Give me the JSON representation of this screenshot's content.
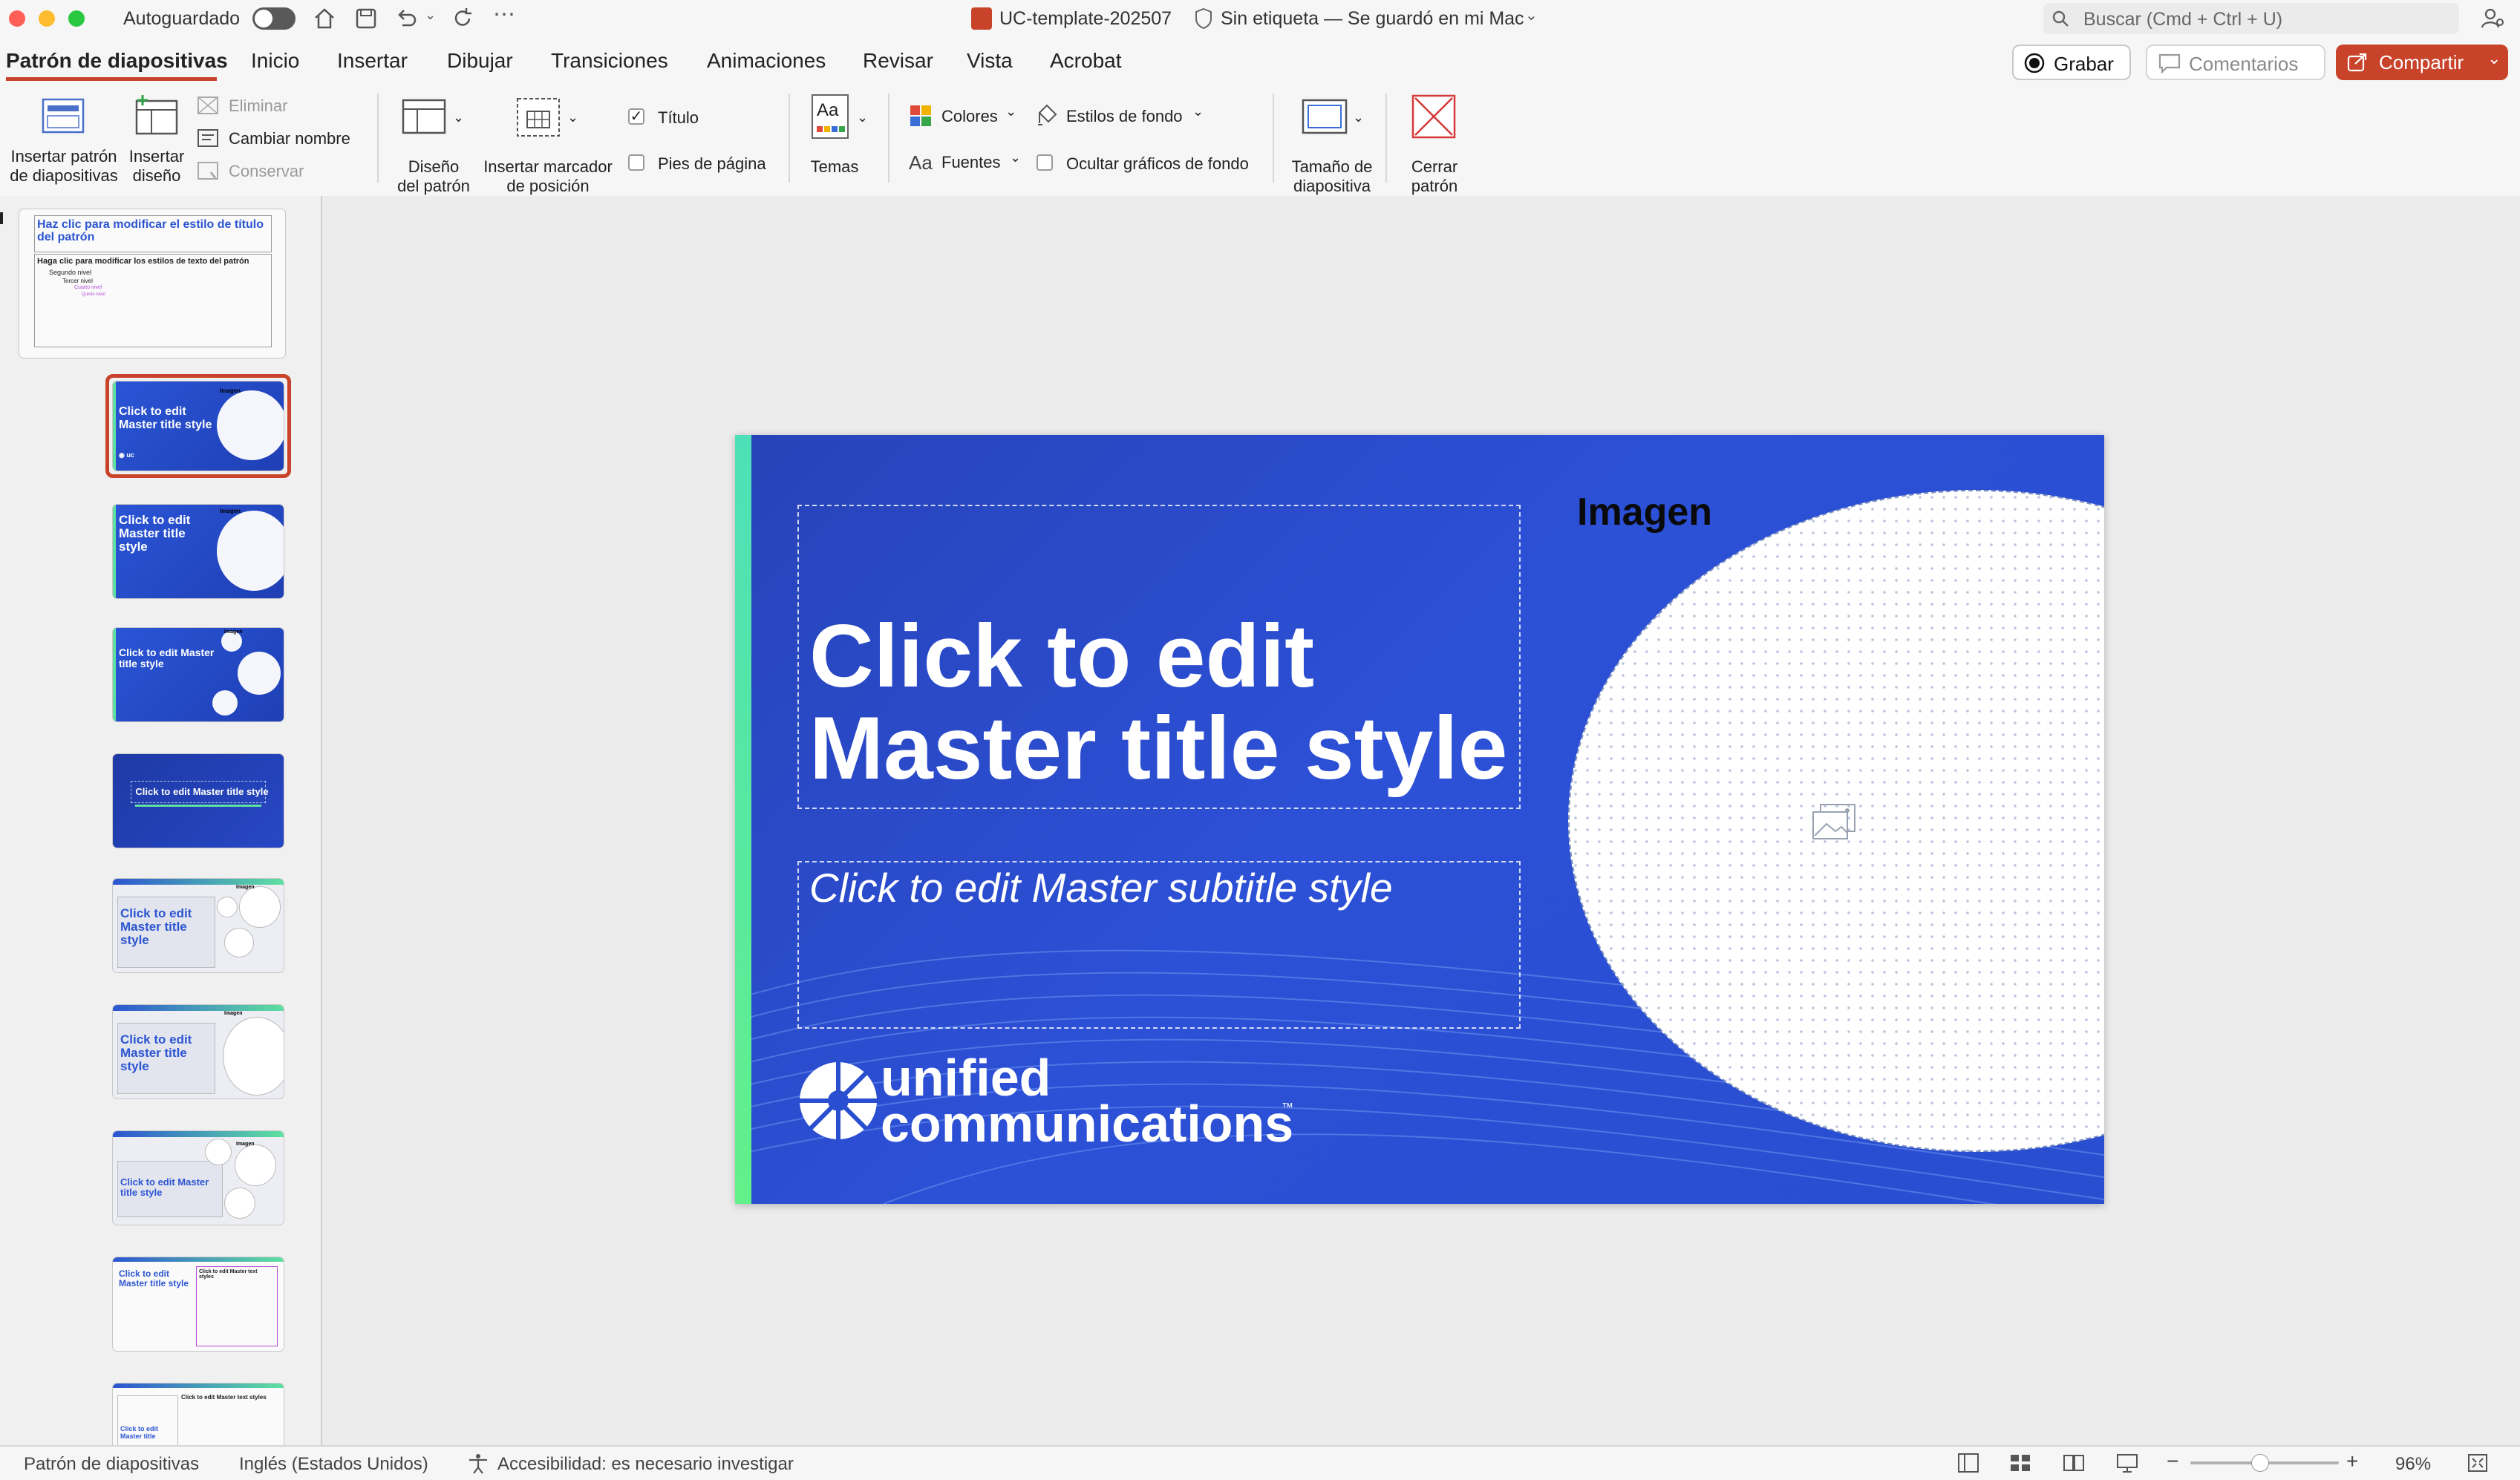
{
  "window": {
    "autosave_label": "Autoguardado",
    "file_name": "UC-template-202507",
    "file_status": "Sin etiqueta — Se guardó en mi Mac",
    "search_placeholder": "Buscar (Cmd + Ctrl + U)"
  },
  "tabs": [
    "Patrón de diapositivas",
    "Inicio",
    "Insertar",
    "Dibujar",
    "Transiciones",
    "Animaciones",
    "Revisar",
    "Vista",
    "Acrobat"
  ],
  "actions": {
    "record": "Grabar",
    "comments": "Comentarios",
    "share": "Compartir"
  },
  "ribbon": {
    "insert_master": [
      "Insertar patrón",
      "de diapositivas"
    ],
    "insert_layout": [
      "Insertar",
      "diseño"
    ],
    "delete": "Eliminar",
    "rename": "Cambiar nombre",
    "preserve": "Conservar",
    "master_layout": [
      "Diseño",
      "del patrón"
    ],
    "insert_placeholder": [
      "Insertar marcador",
      "de posición"
    ],
    "title_check": "Título",
    "footer_check": "Pies de página",
    "themes": "Temas",
    "colors": "Colores",
    "fonts": "Fuentes",
    "background_styles": "Estilos de fondo",
    "hide_background": "Ocultar gráficos de fondo",
    "slide_size": [
      "Tamaño de",
      "diapositiva"
    ],
    "close_master": [
      "Cerrar",
      "patrón"
    ]
  },
  "thumbnails": {
    "master": {
      "title": "Haz clic para modificar el estilo de título del patrón",
      "body": "Haga clic para modificar los estilos de texto del patrón",
      "level2": "Segundo nivel",
      "level3": "Tercer nivel",
      "level4": "Cuarto nivel",
      "level5": "Quinto nivel"
    },
    "layouts": [
      {
        "title": "Click to edit Master title style",
        "label": "Imagen"
      },
      {
        "title": "Click to edit Master title style",
        "label": "Imagen"
      },
      {
        "title": "Click to edit Master title style",
        "label": "Imagen"
      },
      {
        "title": "Click to edit Master title style",
        "label": ""
      },
      {
        "title": "Click to edit Master title style",
        "label": "Imagen"
      },
      {
        "title": "Click to edit Master title style",
        "label": "Imagen"
      },
      {
        "title": "Click to edit Master title style",
        "label": "Imagen"
      },
      {
        "title": "Click to edit Master title style",
        "label": "Click to edit Master text styles"
      },
      {
        "title": "Click to edit Master title",
        "label": "Click to edit Master text styles"
      }
    ]
  },
  "slide": {
    "title_line1": "Click to edit",
    "title_line2": "Master title style",
    "subtitle": "Click to edit Master subtitle style",
    "image_label": "Imagen",
    "logo_line1": "unified",
    "logo_line2": "communications",
    "logo_tm": "™"
  },
  "status": {
    "view": "Patrón de diapositivas",
    "language": "Inglés (Estados Unidos)",
    "accessibility": "Accesibilidad: es necesario investigar",
    "zoom": "96%"
  },
  "colors": {
    "accent_red": "#c8432a",
    "slide_blue": "#2a4ed0",
    "title_blue": "#2c55d1"
  }
}
